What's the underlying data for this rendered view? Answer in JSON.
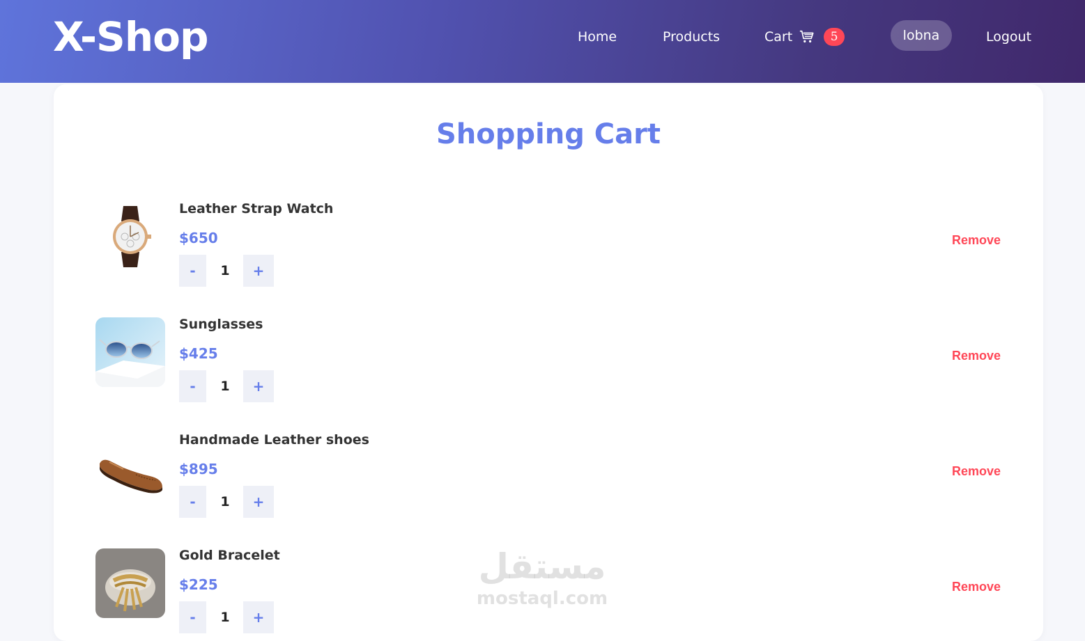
{
  "brand": {
    "name": "X-Shop"
  },
  "nav": {
    "home": "Home",
    "products": "Products",
    "cart_label": "Cart",
    "cart_icon": "cart-icon",
    "cart_count": "5",
    "user": "lobna",
    "logout": "Logout"
  },
  "page": {
    "title": "Shopping Cart"
  },
  "cart": {
    "items": [
      {
        "name": "Leather Strap Watch",
        "price": "$650",
        "quantity": "1",
        "image": "watch-image"
      },
      {
        "name": "Sunglasses",
        "price": "$425",
        "quantity": "1",
        "image": "sunglasses-image"
      },
      {
        "name": "Handmade Leather shoes",
        "price": "$895",
        "quantity": "1",
        "image": "shoes-image"
      },
      {
        "name": "Gold Bracelet",
        "price": "$225",
        "quantity": "1",
        "image": "bracelet-image"
      }
    ],
    "minus_label": "-",
    "plus_label": "+",
    "remove_label": "Remove"
  },
  "watermark": {
    "arabic": "مستقل",
    "latin": "mostaql.com"
  },
  "colors": {
    "accent": "#667eea",
    "danger": "#ff4757",
    "nav_gradient_start": "#5f74db",
    "nav_gradient_end": "#40286b"
  }
}
